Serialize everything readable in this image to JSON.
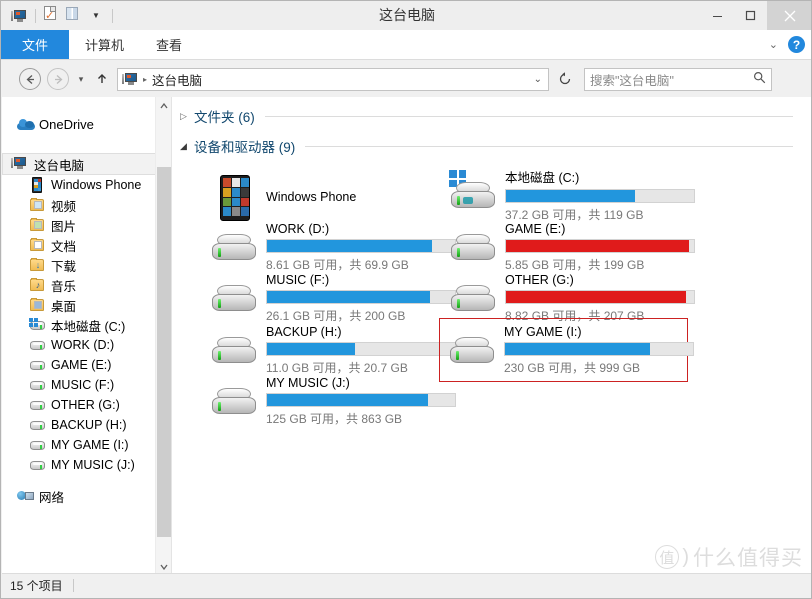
{
  "window": {
    "title": "这台电脑",
    "minimize_label": "—",
    "maximize_label": "▢",
    "close_label": "✕"
  },
  "quick_access_toolbar": {
    "icons": [
      "this-pc-icon",
      "properties-icon",
      "navigation-pane-icon",
      "customize-dropdown-icon"
    ]
  },
  "ribbon": {
    "tabs": [
      {
        "label": "文件",
        "active": true
      },
      {
        "label": "计算机",
        "active": false
      },
      {
        "label": "查看",
        "active": false
      }
    ],
    "minimize_ribbon_icon": "chevron-down-icon",
    "help_label": "?"
  },
  "navigation": {
    "back_label": "←",
    "forward_label": "→",
    "recent_label": "▾",
    "up_label": "↑",
    "address": {
      "icon": "this-pc-icon",
      "separator": "▸",
      "crumb": "这台电脑",
      "dropdown_label": "⌄"
    },
    "refresh_label": "↻",
    "search": {
      "placeholder": "搜索\"这台电脑\"",
      "value": "",
      "icon_label": "⌕"
    }
  },
  "sidebar": {
    "scroll": {
      "up_label": "⌃",
      "down_label": "⌄"
    },
    "items": [
      {
        "label": "OneDrive",
        "icon": "onedrive-cloud-icon",
        "level": 0,
        "kind": "cloud"
      },
      {
        "label": "这台电脑",
        "icon": "this-pc-icon",
        "level": 0,
        "kind": "thispc",
        "selected": true
      },
      {
        "label": "Windows Phone",
        "icon": "phone-icon",
        "level": 1,
        "kind": "phone"
      },
      {
        "label": "视频",
        "icon": "folder-video-icon",
        "level": 1,
        "kind": "folder-vid"
      },
      {
        "label": "图片",
        "icon": "folder-pictures-icon",
        "level": 1,
        "kind": "folder-pic"
      },
      {
        "label": "文档",
        "icon": "folder-documents-icon",
        "level": 1,
        "kind": "folder-doc"
      },
      {
        "label": "下载",
        "icon": "folder-downloads-icon",
        "level": 1,
        "kind": "folder-dl"
      },
      {
        "label": "音乐",
        "icon": "folder-music-icon",
        "level": 1,
        "kind": "folder-mus"
      },
      {
        "label": "桌面",
        "icon": "folder-desktop-icon",
        "level": 1,
        "kind": "folder-desk"
      },
      {
        "label": "本地磁盘 (C:)",
        "icon": "system-drive-icon",
        "level": 1,
        "kind": "drive-sys"
      },
      {
        "label": "WORK (D:)",
        "icon": "drive-icon",
        "level": 1,
        "kind": "drive"
      },
      {
        "label": "GAME (E:)",
        "icon": "drive-icon",
        "level": 1,
        "kind": "drive"
      },
      {
        "label": "MUSIC (F:)",
        "icon": "drive-icon",
        "level": 1,
        "kind": "drive"
      },
      {
        "label": "OTHER (G:)",
        "icon": "drive-icon",
        "level": 1,
        "kind": "drive"
      },
      {
        "label": "BACKUP (H:)",
        "icon": "drive-icon",
        "level": 1,
        "kind": "drive"
      },
      {
        "label": "MY GAME (I:)",
        "icon": "drive-icon",
        "level": 1,
        "kind": "drive"
      },
      {
        "label": "MY MUSIC (J:)",
        "icon": "drive-icon",
        "level": 1,
        "kind": "drive"
      },
      {
        "label": "网络",
        "icon": "network-icon",
        "level": 0,
        "kind": "network"
      }
    ]
  },
  "content": {
    "groups": [
      {
        "title": "文件夹 (6)",
        "collapsed": true,
        "triangle": "▷"
      },
      {
        "title": "设备和驱动器 (9)",
        "collapsed": false,
        "triangle": "◢"
      }
    ],
    "accent_blue": "#2296dd",
    "accent_red": "#e01b1b",
    "selection_border": "#cc2222",
    "items": [
      {
        "name": "Windows Phone",
        "icon": "windows-phone-device-icon",
        "has_bar": false,
        "bar_percent": 0,
        "bar_color": "",
        "sub": "",
        "selected": false,
        "col": 0,
        "row": 0
      },
      {
        "name": "本地磁盘 (C:)",
        "icon": "system-drive-icon",
        "has_bar": true,
        "bar_percent": 68.7,
        "bar_color": "#2296dd",
        "free": "37.2 GB",
        "total": "119 GB",
        "sub": "37.2 GB 可用，共 119 GB",
        "selected": false,
        "col": 1,
        "row": 0
      },
      {
        "name": "WORK (D:)",
        "icon": "drive-icon",
        "has_bar": true,
        "bar_percent": 87.7,
        "bar_color": "#2296dd",
        "free": "8.61 GB",
        "total": "69.9 GB",
        "sub": "8.61 GB 可用，共 69.9 GB",
        "selected": false,
        "col": 0,
        "row": 1
      },
      {
        "name": "GAME (E:)",
        "icon": "drive-icon",
        "has_bar": true,
        "bar_percent": 97.1,
        "bar_color": "#e01b1b",
        "free": "5.85 GB",
        "total": "199 GB",
        "sub": "5.85 GB 可用，共 199 GB",
        "selected": false,
        "col": 1,
        "row": 1
      },
      {
        "name": "MUSIC (F:)",
        "icon": "drive-icon",
        "has_bar": true,
        "bar_percent": 86.9,
        "bar_color": "#2296dd",
        "free": "26.1 GB",
        "total": "200 GB",
        "sub": "26.1 GB 可用，共 200 GB",
        "selected": false,
        "col": 0,
        "row": 2
      },
      {
        "name": "OTHER (G:)",
        "icon": "drive-icon",
        "has_bar": true,
        "bar_percent": 95.7,
        "bar_color": "#e01b1b",
        "free": "8.82 GB",
        "total": "207 GB",
        "sub": "8.82 GB 可用，共 207 GB",
        "selected": false,
        "col": 1,
        "row": 2
      },
      {
        "name": "BACKUP (H:)",
        "icon": "drive-icon",
        "has_bar": true,
        "bar_percent": 46.9,
        "bar_color": "#2296dd",
        "free": "11.0 GB",
        "total": "20.7 GB",
        "sub": "11.0 GB 可用，共 20.7 GB",
        "selected": false,
        "col": 0,
        "row": 3
      },
      {
        "name": "MY GAME (I:)",
        "icon": "drive-icon",
        "has_bar": true,
        "bar_percent": 77.0,
        "bar_color": "#2296dd",
        "free": "230 GB",
        "total": "999 GB",
        "sub": "230 GB 可用，共 999 GB",
        "selected": true,
        "col": 1,
        "row": 3
      },
      {
        "name": "MY MUSIC (J:)",
        "icon": "drive-icon",
        "has_bar": true,
        "bar_percent": 85.5,
        "bar_color": "#2296dd",
        "free": "125 GB",
        "total": "863 GB",
        "sub": "125 GB 可用，共 863 GB",
        "selected": false,
        "col": 0,
        "row": 4
      }
    ]
  },
  "statusbar": {
    "item_count_text": "15 个项目"
  },
  "watermark": {
    "mark": "值",
    "paren": ")",
    "text": "什么值得买"
  }
}
